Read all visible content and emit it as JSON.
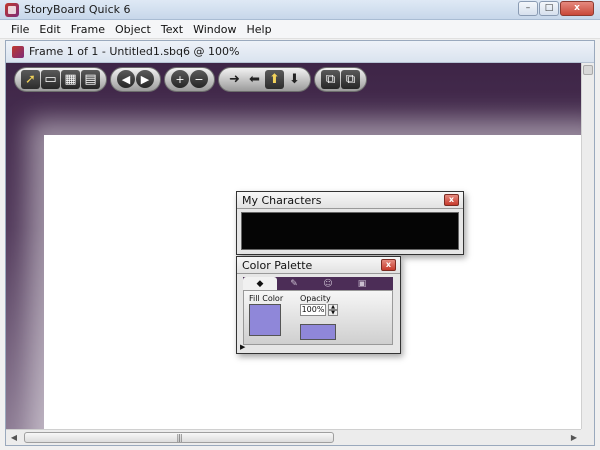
{
  "window": {
    "title": "StoryBoard Quick 6",
    "controls": {
      "minimize": "–",
      "maximize": "□",
      "close": "x"
    }
  },
  "menu": [
    "File",
    "Edit",
    "Frame",
    "Object",
    "Text",
    "Window",
    "Help"
  ],
  "document": {
    "title": "Frame 1 of 1 - Untitled1.sbq6 @ 100%"
  },
  "toolbar": {
    "groups": [
      [
        "pointer-icon",
        "frame-view-icon",
        "grid-view-icon",
        "list-view-icon"
      ],
      [
        "prev-icon",
        "next-icon"
      ],
      [
        "add-icon",
        "remove-icon"
      ],
      [
        "move-right-icon",
        "move-left-icon",
        "move-up-icon",
        "move-down-icon"
      ],
      [
        "bring-forward-icon",
        "send-backward-icon"
      ]
    ]
  },
  "my_characters": {
    "title": "My Characters",
    "close": "x"
  },
  "color_palette": {
    "title": "Color Palette",
    "close": "x",
    "tabs": [
      "paint-bucket-icon",
      "brush-icon",
      "face-icon",
      "car-icon"
    ],
    "fill_label": "Fill Color",
    "opacity_label": "Opacity",
    "opacity_value": "100%",
    "fill_color": "#8f87d9"
  },
  "colors": {
    "stage_top": "#3e2547",
    "accent": "#4c2d57",
    "close_red": "#c63a2c"
  }
}
